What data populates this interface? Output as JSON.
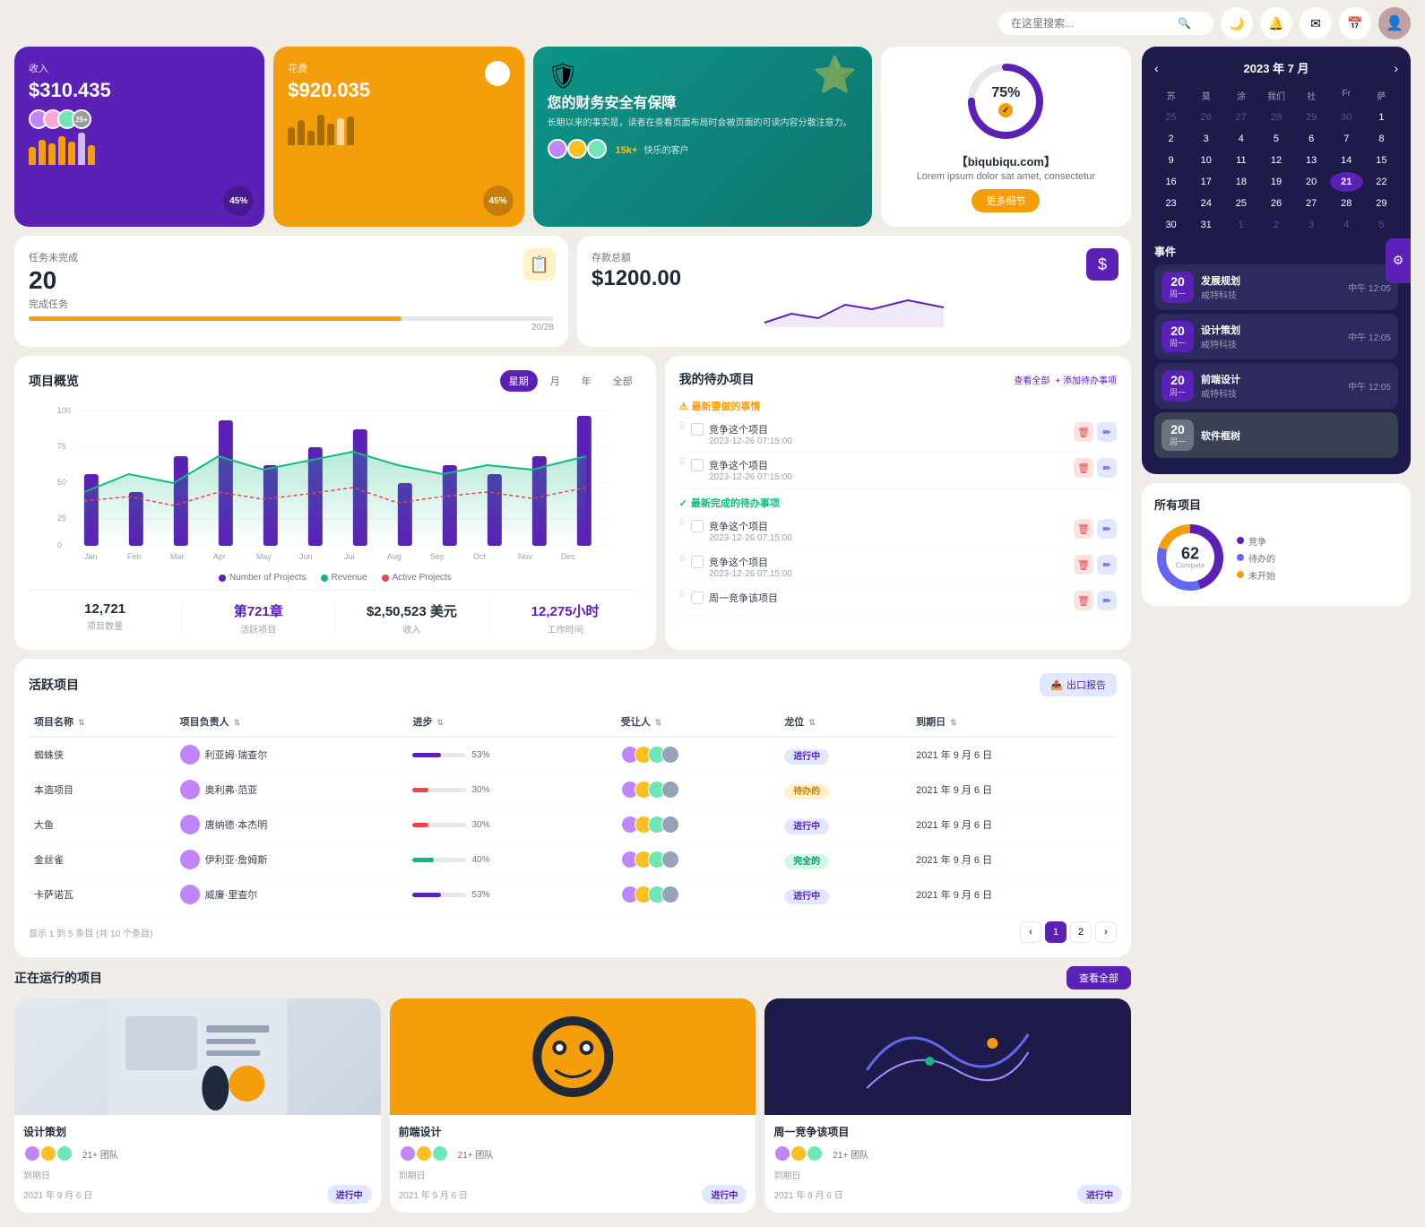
{
  "topbar": {
    "search_placeholder": "在这里搜索...",
    "moon_icon": "🌙",
    "bell_icon": "🔔",
    "mail_icon": "✉",
    "calendar_icon": "📅"
  },
  "revenue_card": {
    "title": "收入",
    "amount": "$310.435",
    "percent": "45%",
    "bars": [
      30,
      55,
      45,
      65,
      50,
      70,
      40
    ]
  },
  "expense_card": {
    "title": "花费",
    "amount": "$920.035",
    "percent": "45%",
    "bars": [
      40,
      60,
      35,
      70,
      45,
      55,
      65
    ]
  },
  "banner_card": {
    "title": "您的财务安全有保障",
    "desc": "长期以来的事实是，读者在查看页面布局时会被页面的可读内容分散注意力。",
    "clients_count": "15k+",
    "clients_label": "快乐的客户"
  },
  "circular_card": {
    "percent": "75%",
    "site": "【biqubiqu.com】",
    "desc": "Lorem ipsum dolor sat amet, consectetur",
    "btn": "更多细节"
  },
  "task_card": {
    "title": "任务未完成",
    "count": "20",
    "label": "完成任务",
    "progress_label": "20/28",
    "progress_pct": 71
  },
  "savings_card": {
    "title": "存款总额",
    "amount": "$1200.00"
  },
  "proj_overview": {
    "title": "项目概览",
    "filters": [
      "星期",
      "月",
      "年",
      "全部"
    ],
    "active_filter": 0,
    "legend": [
      {
        "label": "Number of Projects",
        "color": "#5b21b6"
      },
      {
        "label": "Revenue",
        "color": "#10b981"
      },
      {
        "label": "Active Projects",
        "color": "#ef4444"
      }
    ],
    "x_labels": [
      "Jan",
      "Feb",
      "Mar",
      "Apr",
      "May",
      "Jun",
      "Jul",
      "Aug",
      "Sep",
      "Oct",
      "Nov",
      "Dec"
    ],
    "y_labels": [
      "100",
      "75",
      "50",
      "25",
      "0"
    ],
    "stats": [
      {
        "val": "12,721",
        "label": "项目数量"
      },
      {
        "val": "第721章",
        "label": "活跃项目"
      },
      {
        "val": "$2,50,523 美元",
        "label": "收入"
      },
      {
        "val": "12,275小时",
        "label": "工作时间"
      }
    ]
  },
  "todo": {
    "title": "我的待办项目",
    "view_all": "查看全部",
    "add_label": "+ 添加待办事项",
    "urgent_label": "最新要做的事情",
    "complete_label": "最新完成的待办事项",
    "items_urgent": [
      {
        "text": "竞争这个项目",
        "date": "2023-12-26 07:15:00",
        "done": false
      },
      {
        "text": "竞争这个项目",
        "date": "2023-12-26 07:15:00",
        "done": false
      },
      {
        "text": "竞争这个项目",
        "date": "2023-12-26 07:15:00",
        "done": false
      },
      {
        "text": "周一竞争该项目",
        "date": "",
        "done": false
      }
    ]
  },
  "active_projects": {
    "title": "活跃项目",
    "export_btn": "出口报告",
    "columns": [
      "项目名称",
      "项目负责人",
      "进步",
      "受让人",
      "龙位",
      "到期日"
    ],
    "rows": [
      {
        "name": "蜘蛛侠",
        "manager": "利亚姆·瑞查尔",
        "progress": 53,
        "progress_color": "#5b21b6",
        "status": "进行中",
        "status_class": "status-active",
        "due": "2021 年 9 月 6 日"
      },
      {
        "name": "本造项目",
        "manager": "奥利弗·范亚",
        "progress": 30,
        "progress_color": "#ef4444",
        "status": "待办的",
        "status_class": "status-pending",
        "due": "2021 年 9 月 6 日"
      },
      {
        "name": "大鱼",
        "manager": "唐纳德·本杰明",
        "progress": 30,
        "progress_color": "#ef4444",
        "status": "进行中",
        "status_class": "status-active",
        "due": "2021 年 9 月 6 日"
      },
      {
        "name": "金丝雀",
        "manager": "伊利亚·詹姆斯",
        "progress": 40,
        "progress_color": "#10b981",
        "status": "完全的",
        "status_class": "status-complete",
        "due": "2021 年 9 月 6 日"
      },
      {
        "name": "卡萨诺瓦",
        "manager": "威廉·里查尔",
        "progress": 53,
        "progress_color": "#5b21b6",
        "status": "进行中",
        "status_class": "status-active",
        "due": "2021 年 9 月 6 日"
      }
    ],
    "page_info": "显示 1 到 5 条目 (共 10 个条目)",
    "current_page": 1,
    "pages": [
      1,
      2
    ]
  },
  "running_projects": {
    "title": "正在运行的项目",
    "view_all": "查看全部",
    "projects": [
      {
        "name": "设计策划",
        "team": "21+ 团队",
        "due_label": "到期日",
        "due": "2021 年 9 月 6 日",
        "status": "进行中",
        "status_class": "status-active",
        "thumb_class": "proj-thumb-design"
      },
      {
        "name": "前端设计",
        "team": "21+ 团队",
        "due_label": "到期日",
        "due": "2021 年 9 月 6 日",
        "status": "进行中",
        "status_class": "status-active",
        "thumb_class": "proj-thumb-frontend"
      },
      {
        "name": "周一竞争该项目",
        "team": "21+ 团队",
        "due_label": "到期日",
        "due": "2021 年 9 月 6 日",
        "status": "进行中",
        "status_class": "status-active",
        "thumb_class": "proj-thumb-compete"
      }
    ]
  },
  "calendar": {
    "title": "2023 年 7 月",
    "day_headers": [
      "苏",
      "莫",
      "涂",
      "我们",
      "社",
      "Fr",
      "萨"
    ],
    "days": [
      {
        "n": "25",
        "m": true
      },
      {
        "n": "26",
        "m": true
      },
      {
        "n": "27",
        "m": true
      },
      {
        "n": "28",
        "m": true
      },
      {
        "n": "29",
        "m": true
      },
      {
        "n": "30",
        "m": true
      },
      {
        "n": "1",
        "m": false
      },
      {
        "n": "2",
        "m": false
      },
      {
        "n": "3",
        "m": false
      },
      {
        "n": "4",
        "m": false
      },
      {
        "n": "5",
        "m": false
      },
      {
        "n": "6",
        "m": false
      },
      {
        "n": "7",
        "m": false
      },
      {
        "n": "8",
        "m": false
      },
      {
        "n": "9",
        "m": false
      },
      {
        "n": "10",
        "m": false
      },
      {
        "n": "11",
        "m": false
      },
      {
        "n": "12",
        "m": false
      },
      {
        "n": "13",
        "m": false
      },
      {
        "n": "14",
        "m": false
      },
      {
        "n": "15",
        "m": false
      },
      {
        "n": "16",
        "m": false
      },
      {
        "n": "17",
        "m": false
      },
      {
        "n": "18",
        "m": false
      },
      {
        "n": "19",
        "m": false
      },
      {
        "n": "20",
        "m": false
      },
      {
        "n": "21",
        "today": true
      },
      {
        "n": "22",
        "m": false
      },
      {
        "n": "23",
        "m": false
      },
      {
        "n": "24",
        "m": false
      },
      {
        "n": "25",
        "m": false
      },
      {
        "n": "26",
        "m": false
      },
      {
        "n": "27",
        "m": false
      },
      {
        "n": "28",
        "m": false
      },
      {
        "n": "29",
        "m": false
      },
      {
        "n": "30",
        "m": false
      },
      {
        "n": "31",
        "m": false
      },
      {
        "n": "1",
        "m": true
      },
      {
        "n": "2",
        "m": true
      },
      {
        "n": "3",
        "m": true
      },
      {
        "n": "4",
        "m": true
      },
      {
        "n": "5",
        "m": true
      }
    ],
    "events_label": "事件",
    "events": [
      {
        "day": "20",
        "weekday": "周一",
        "name": "发展规划",
        "company": "威特科技",
        "time": "中午 12:05",
        "style": "dark"
      },
      {
        "day": "20",
        "weekday": "周一",
        "name": "设计策划",
        "company": "威特科技",
        "time": "中午 12:05",
        "style": "dark"
      },
      {
        "day": "20",
        "weekday": "周一",
        "name": "前端设计",
        "company": "威特科技",
        "time": "中午 12:05",
        "style": "dark"
      },
      {
        "day": "20",
        "weekday": "周一",
        "name": "软件框树",
        "company": "",
        "time": "",
        "style": "gray"
      }
    ]
  },
  "all_projects": {
    "title": "所有项目",
    "total": "62",
    "total_label": "Compete",
    "legend": [
      {
        "label": "竞争",
        "color": "#5b21b6"
      },
      {
        "label": "待办的",
        "color": "#6366f1"
      },
      {
        "label": "未开始",
        "color": "#f59e0b"
      }
    ]
  }
}
